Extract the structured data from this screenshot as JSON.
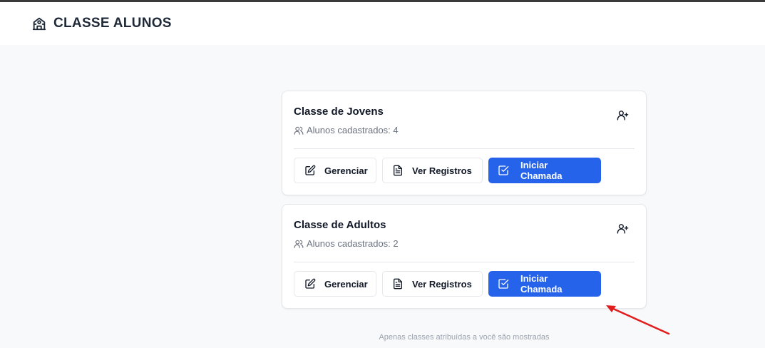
{
  "header": {
    "title": "CLASSE ALUNOS",
    "icon": "school-icon"
  },
  "classes": [
    {
      "name": "Classe de Jovens",
      "count_label": "Alunos cadastrados: 4",
      "actions": {
        "manage": "Gerenciar",
        "records": "Ver Registros",
        "start": "Iniciar Chamada"
      }
    },
    {
      "name": "Classe de Adultos",
      "count_label": "Alunos cadastrados: 2",
      "actions": {
        "manage": "Gerenciar",
        "records": "Ver Registros",
        "start": "Iniciar Chamada"
      }
    }
  ],
  "footer": {
    "note": "Apenas classes atribuídas a você são mostradas"
  },
  "colors": {
    "primary": "#2563eb",
    "annotation_arrow": "#e11d1d"
  }
}
